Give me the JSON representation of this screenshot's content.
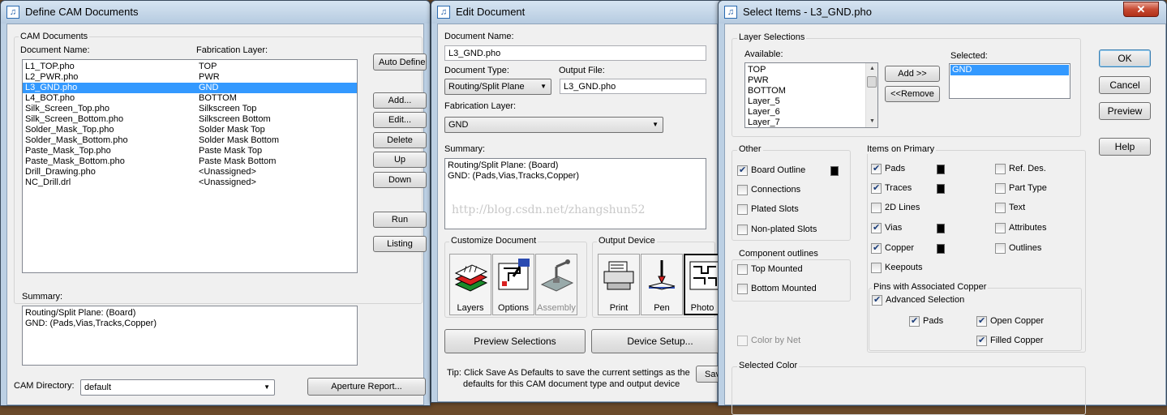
{
  "cam": {
    "title": "Define CAM Documents",
    "group_label": "CAM Documents",
    "col_name": "Document Name:",
    "col_layer": "Fabrication Layer:",
    "rows": [
      {
        "name": "L1_TOP.pho",
        "layer": "TOP",
        "selected": false
      },
      {
        "name": "L2_PWR.pho",
        "layer": "PWR",
        "selected": false
      },
      {
        "name": "L3_GND.pho",
        "layer": "GND",
        "selected": true
      },
      {
        "name": "L4_BOT.pho",
        "layer": "BOTTOM",
        "selected": false
      },
      {
        "name": "Silk_Screen_Top.pho",
        "layer": "Silkscreen Top",
        "selected": false
      },
      {
        "name": "Silk_Screen_Bottom.pho",
        "layer": "Silkscreen Bottom",
        "selected": false
      },
      {
        "name": "Solder_Mask_Top.pho",
        "layer": "Solder Mask Top",
        "selected": false
      },
      {
        "name": "Solder_Mask_Bottom.pho",
        "layer": "Solder Mask Bottom",
        "selected": false
      },
      {
        "name": "Paste_Mask_Top.pho",
        "layer": "Paste Mask Top",
        "selected": false
      },
      {
        "name": "Paste_Mask_Bottom.pho",
        "layer": "Paste Mask Bottom",
        "selected": false
      },
      {
        "name": "Drill_Drawing.pho",
        "layer": "<Unassigned>",
        "selected": false
      },
      {
        "name": "NC_Drill.drl",
        "layer": "<Unassigned>",
        "selected": false
      }
    ],
    "buttons": {
      "auto_define": "Auto Define",
      "add": "Add...",
      "edit": "Edit...",
      "delete": "Delete",
      "up": "Up",
      "down": "Down",
      "run": "Run",
      "listing": "Listing"
    },
    "summary_label": "Summary:",
    "summary_lines": [
      "Routing/Split Plane: (Board)",
      "GND: (Pads,Vias,Tracks,Copper)"
    ],
    "directory_label": "CAM Directory:",
    "directory_value": "default",
    "aperture_button": "Aperture Report..."
  },
  "edit": {
    "title": "Edit Document",
    "doc_name_label": "Document Name:",
    "doc_name_value": "L3_GND.pho",
    "doc_type_label": "Document Type:",
    "doc_type_value": "Routing/Split Plane",
    "output_file_label": "Output File:",
    "output_file_value": "L3_GND.pho",
    "fab_layer_label": "Fabrication Layer:",
    "fab_layer_value": "GND",
    "summary_label": "Summary:",
    "summary_lines": [
      "Routing/Split Plane: (Board)",
      "GND: (Pads,Vias,Tracks,Copper)"
    ],
    "watermark": "http://blog.csdn.net/zhangshun52",
    "customize_label": "Customize Document",
    "customize_items": [
      {
        "label": "Layers",
        "icon": "layers-icon",
        "enabled": true
      },
      {
        "label": "Options",
        "icon": "options-icon",
        "enabled": true
      },
      {
        "label": "Assembly",
        "icon": "assembly-icon",
        "enabled": false
      }
    ],
    "output_label": "Output Device",
    "output_items": [
      {
        "label": "Print",
        "icon": "printer-icon"
      },
      {
        "label": "Pen",
        "icon": "pen-plotter-icon"
      },
      {
        "label": "Photo",
        "icon": "photo-plotter-icon"
      }
    ],
    "preview_button": "Preview Selections",
    "device_button": "Device Setup...",
    "tip_line1": "Tip: Click Save As Defaults to save the current settings as the",
    "tip_line2": "defaults for this CAM document type and output device",
    "save_button_partial": "Save"
  },
  "select": {
    "title": "Select Items - L3_GND.pho",
    "layer_group": "Layer Selections",
    "available_label": "Available:",
    "available": [
      "TOP",
      "PWR",
      "BOTTOM",
      "Layer_5",
      "Layer_6",
      "Layer_7"
    ],
    "selected_label": "Selected:",
    "selected": [
      "GND"
    ],
    "add_button": "Add >>",
    "remove_button": "<<Remove",
    "ok": "OK",
    "cancel": "Cancel",
    "preview": "Preview",
    "help": "Help",
    "other_label": "Other",
    "other": [
      {
        "label": "Board Outline",
        "checked": true,
        "color": true
      },
      {
        "label": "Connections",
        "checked": false,
        "color": false
      },
      {
        "label": "Plated Slots",
        "checked": false,
        "color": false
      },
      {
        "label": "Non-plated Slots",
        "checked": false,
        "color": false
      }
    ],
    "component_label": "Component outlines",
    "component": [
      {
        "label": "Top Mounted",
        "checked": false
      },
      {
        "label": "Bottom Mounted",
        "checked": false
      }
    ],
    "color_by_net": "Color by Net",
    "primary_label": "Items on Primary",
    "primary_left": [
      {
        "label": "Pads",
        "checked": true,
        "color": true
      },
      {
        "label": "Traces",
        "checked": true,
        "color": true
      },
      {
        "label": "2D Lines",
        "checked": false,
        "color": false
      },
      {
        "label": "Vias",
        "checked": true,
        "color": true
      },
      {
        "label": "Copper",
        "checked": true,
        "color": true
      },
      {
        "label": "Keepouts",
        "checked": false,
        "color": false
      }
    ],
    "primary_right": [
      {
        "label": "Ref. Des.",
        "checked": false
      },
      {
        "label": "Part Type",
        "checked": false
      },
      {
        "label": "Text",
        "checked": false
      },
      {
        "label": "Attributes",
        "checked": false
      },
      {
        "label": "Outlines",
        "checked": false
      }
    ],
    "pins_label": "Pins with Associated Copper",
    "advanced": {
      "label": "Advanced Selection",
      "checked": true
    },
    "pins_pads": {
      "label": "Pads",
      "checked": true
    },
    "open_copper": {
      "label": "Open Copper",
      "checked": true
    },
    "filled_copper": {
      "label": "Filled Copper",
      "checked": true
    },
    "selected_color_label": "Selected Color"
  },
  "colors": {
    "selection": "#3399ff",
    "swatch": "#000000",
    "titlebar": "#c9dbee",
    "close": "#c74a32"
  }
}
